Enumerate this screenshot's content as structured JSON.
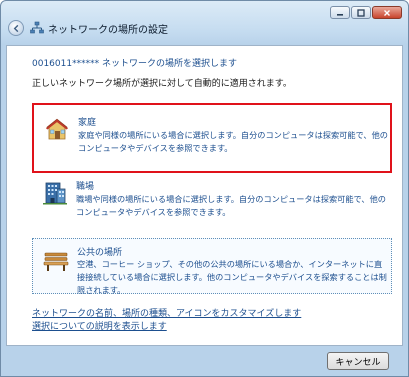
{
  "window": {
    "title": "ネットワークの場所の設定"
  },
  "content": {
    "adapter_line": "0016011****** ネットワークの場所を選択します",
    "description": "正しいネットワーク場所が選択に対して自動的に適用されます。"
  },
  "options": [
    {
      "title": "家庭",
      "description": "家庭や同様の場所にいる場合に選択します。自分のコンピュータは探索可能で、他のコンピュータやデバイスを参照できます。",
      "icon": "house-icon",
      "selected": true
    },
    {
      "title": "職場",
      "description": "職場や同様の場所にいる場合に選択します。自分のコンピュータは探索可能で、他のコンピュータやデバイスを参照できます。",
      "icon": "office-building-icon",
      "selected": false
    },
    {
      "title": "公共の場所",
      "description": "空港、コーヒー ショップ、その他の公共の場所にいる場合か、インターネットに直接接続している場合に選択します。他のコンピュータやデバイスを探索することは制限されます。",
      "icon": "park-bench-icon",
      "selected": false
    }
  ],
  "links": {
    "customize": "ネットワークの名前、場所の種類、アイコンをカスタマイズします",
    "explain": "選択についての説明を表示します"
  },
  "footer": {
    "cancel_label": "キャンセル"
  },
  "colors": {
    "link": "#1d4f8f",
    "highlight_border": "#e0121a",
    "titlebar": "#c5dcf0"
  }
}
